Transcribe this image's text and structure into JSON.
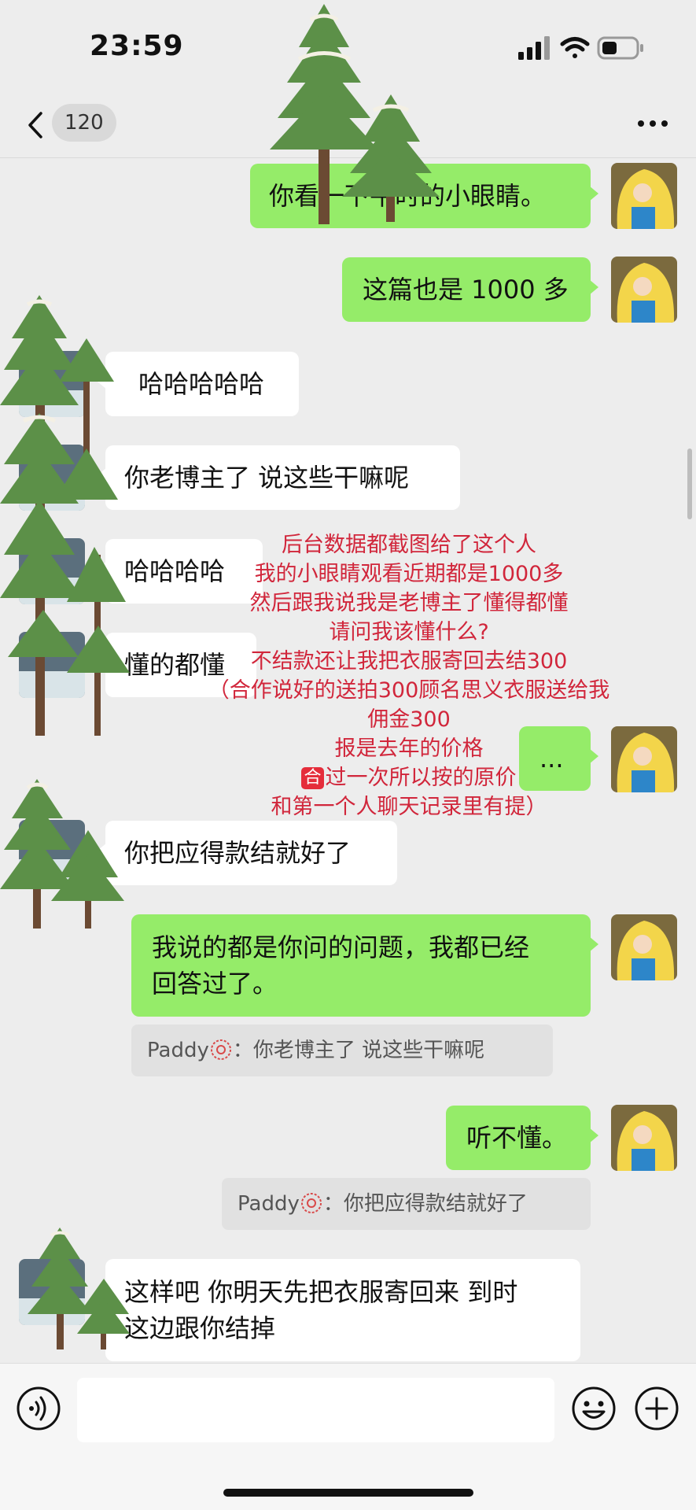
{
  "status_bar": {
    "time": "23:59"
  },
  "header": {
    "unread_count": "120"
  },
  "messages": [
    {
      "side": "me",
      "text": "你看一下平时的小眼睛。"
    },
    {
      "side": "me",
      "text": "这篇也是 1000 多"
    },
    {
      "side": "them",
      "text": "哈哈哈哈哈"
    },
    {
      "side": "them",
      "text": "你老博主了 说这些干嘛呢"
    },
    {
      "side": "them",
      "text": "哈哈哈哈"
    },
    {
      "side": "them",
      "text": "懂的都懂"
    },
    {
      "side": "me",
      "text": "..."
    },
    {
      "side": "them",
      "text": "你把应得款结就好了"
    },
    {
      "side": "me",
      "text_line1": "我说的都是你问的问题，我都已经",
      "text_line2": "回答过了。"
    },
    {
      "side": "me",
      "text": "听不懂。"
    },
    {
      "side": "them",
      "text_line1": "这样吧 你明天先把衣服寄回来 到时",
      "text_line2": "这边跟你结掉"
    }
  ],
  "quotes": [
    {
      "name": "Paddy",
      "text": "：你老博主了 说这些干嘛呢"
    },
    {
      "name": "Paddy",
      "text": "：你把应得款结就好了"
    }
  ],
  "annotation": {
    "lines": [
      "后台数据都截图给了这个人",
      "我的小眼睛观看近期都是1000多",
      "然后跟我说我是老博主了懂得都懂",
      "请问我该懂什么?",
      "不结款还让我把衣服寄回去结300",
      "（合作说好的送拍300顾名思义衣服送给我",
      "佣金300",
      "报是去年的价格",
      "过一次所以按的原价",
      "和第一个人聊天记录里有提）"
    ],
    "badge": "合",
    "color": "#d1263b"
  },
  "colors": {
    "me_bubble": "#95ec69",
    "them_bubble": "#ffffff",
    "background": "#ededed"
  },
  "input_bar": {
    "placeholder": ""
  }
}
